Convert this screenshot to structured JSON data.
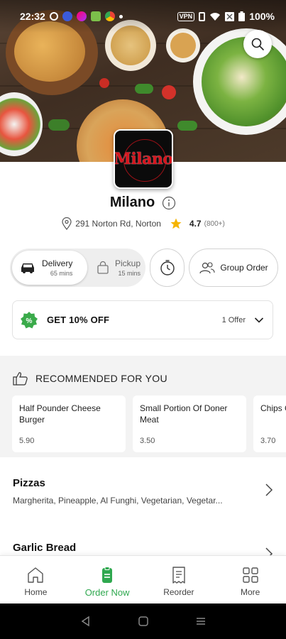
{
  "status_bar": {
    "time": "22:32",
    "battery": "100%",
    "vpn": "VPN"
  },
  "restaurant": {
    "logo_text": "Milano",
    "name": "Milano",
    "address": "291 Norton Rd, Norton",
    "rating": "4.7",
    "rating_count": "(800+)"
  },
  "modes": {
    "delivery": {
      "label": "Delivery",
      "time": "65 mins",
      "selected": true
    },
    "pickup": {
      "label": "Pickup",
      "time": "15 mins",
      "selected": false
    }
  },
  "group_order_label": "Group Order",
  "offer": {
    "title": "GET 10% OFF",
    "count": "1 Offer",
    "badge_symbol": "%"
  },
  "recommended": {
    "title": "RECOMMENDED FOR YOU",
    "items": [
      {
        "name": "Half Pounder Cheese Burger",
        "price": "5.90"
      },
      {
        "name": "Small Portion Of Doner Meat",
        "price": "3.50"
      },
      {
        "name": "Chips Garlic",
        "price": "3.70"
      }
    ]
  },
  "categories": [
    {
      "name": "Pizzas",
      "description": "Margherita, Pineapple, Al Funghi, Vegetarian, Vegetar..."
    },
    {
      "name": "Garlic Bread",
      "description": ""
    }
  ],
  "bottom_nav": [
    {
      "label": "Home",
      "icon": "home-icon",
      "active": false
    },
    {
      "label": "Order Now",
      "icon": "order-now-icon",
      "active": true
    },
    {
      "label": "Reorder",
      "icon": "receipt-icon",
      "active": false
    },
    {
      "label": "More",
      "icon": "grid-icon",
      "active": false
    }
  ],
  "colors": {
    "accent": "#2fa84f",
    "star": "#f5b400",
    "logo_red": "#d8141d"
  }
}
